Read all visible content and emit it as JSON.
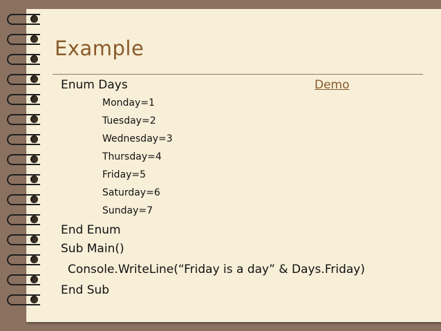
{
  "slide": {
    "title": "Example",
    "demo_link": "Demo",
    "enum_start": "Enum Days",
    "members": [
      "Monday=1",
      "Tuesday=2",
      "Wednesday=3",
      "Thursday=4",
      "Friday=5",
      "Saturday=6",
      "Sunday=7"
    ],
    "enum_end": "End Enum",
    "sub_start": "Sub Main()",
    "console_line": "Console.WriteLine(“Friday is a day” & Days.Friday)",
    "sub_end": "End Sub"
  },
  "colors": {
    "background": "#8b7160",
    "paper": "#f7efd8",
    "accent": "#8a5a2b"
  }
}
